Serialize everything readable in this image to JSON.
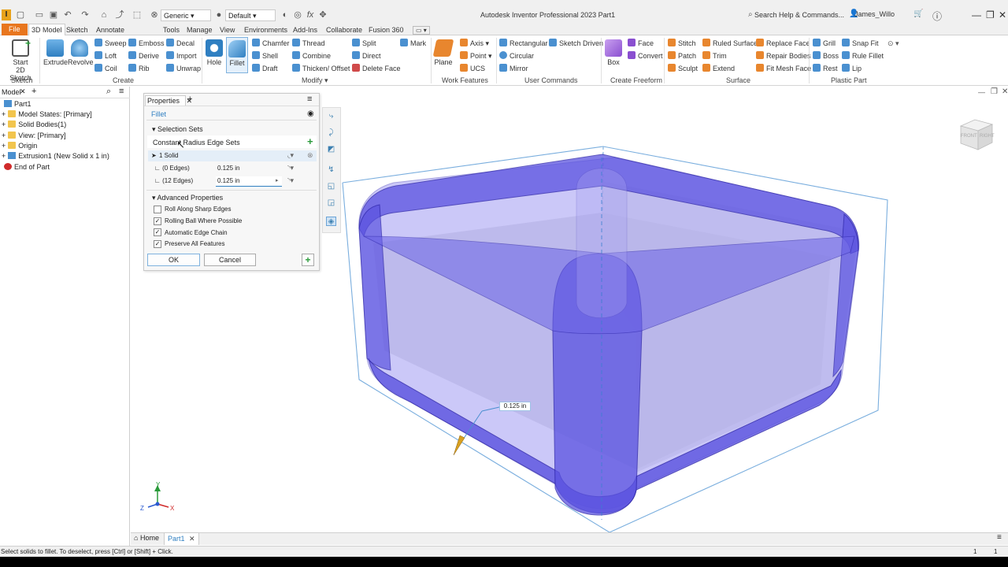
{
  "titlebar": {
    "logo": "I",
    "material_dropdown": "Generic",
    "appearance_dropdown": "Default",
    "window_title": "Autodesk Inventor Professional 2023    Part1",
    "search_placeholder": "Search Help & Commands...",
    "user": "James_Willo"
  },
  "tabs": [
    "File",
    "3D Model",
    "Sketch",
    "Annotate",
    "Tools",
    "Manage",
    "View",
    "Environments",
    "Add-Ins",
    "Collaborate",
    "Fusion 360"
  ],
  "ribbon": {
    "sketch": {
      "start_label": "Start\n2D Sketch",
      "panel": "Sketch"
    },
    "create": {
      "panel": "Create",
      "extrude": "Extrude",
      "revolve": "Revolve",
      "items": [
        "Sweep",
        "Loft",
        "Coil",
        "Emboss",
        "Derive",
        "Rib",
        "Decal",
        "Import",
        "Unwrap"
      ]
    },
    "modify": {
      "panel": "Modify",
      "hole": "Hole",
      "fillet": "Fillet",
      "items": [
        "Chamfer",
        "Shell",
        "Draft",
        "Thread",
        "Combine",
        "Thicken/ Offset",
        "Split",
        "Direct",
        "Delete Face",
        "Mark"
      ]
    },
    "work_features": {
      "panel": "Work Features",
      "plane": "Plane",
      "items": [
        "Axis",
        "Point",
        "UCS"
      ]
    },
    "user_commands": {
      "panel": "User Commands",
      "items": [
        "Rectangular",
        "Circular",
        "Mirror",
        "Sketch Driven"
      ]
    },
    "freeform": {
      "panel": "Create Freeform",
      "box": "Box",
      "items": [
        "Face",
        "Convert"
      ]
    },
    "surface": {
      "panel": "Surface",
      "items": [
        "Stitch",
        "Patch",
        "Sculpt",
        "Ruled Surface",
        "Trim",
        "Extend",
        "Replace Face",
        "Repair Bodies",
        "Fit Mesh Face"
      ]
    },
    "plastic": {
      "panel": "Plastic Part",
      "items": [
        "Grill",
        "Boss",
        "Rest",
        "Snap Fit",
        "Rule Fillet",
        "Lip"
      ]
    }
  },
  "browser": {
    "title": "Model",
    "tree": [
      "Part1",
      "Model States: [Primary]",
      "Solid Bodies(1)",
      "View: [Primary]",
      "Origin",
      "Extrusion1 (New Solid x 1 in)",
      "End of Part"
    ]
  },
  "properties": {
    "tab": "Properties",
    "feature": "Fillet",
    "selection_sets_header": "Selection Sets",
    "edge_sets_label": "Constant Radius Edge Sets",
    "solid_label": "1 Solid",
    "rows": [
      {
        "label": "(0 Edges)",
        "value": "0.125 in"
      },
      {
        "label": "(12 Edges)",
        "value": "0.125 in"
      }
    ],
    "advanced_header": "Advanced Properties",
    "options": [
      {
        "label": "Roll Along Sharp Edges",
        "checked": false
      },
      {
        "label": "Rolling Ball Where Possible",
        "checked": true
      },
      {
        "label": "Automatic Edge Chain",
        "checked": true
      },
      {
        "label": "Preserve All Features",
        "checked": true
      }
    ],
    "ok": "OK",
    "cancel": "Cancel"
  },
  "viewport": {
    "dimension_label": "0.125 in",
    "viewcube_front": "FRONT",
    "viewcube_right": "RIGHT",
    "axes": {
      "x": "X",
      "y": "Y",
      "z": "Z"
    }
  },
  "doc_tabs": {
    "home": "Home",
    "part": "Part1"
  },
  "status": {
    "message": "Select solids to fillet. To deselect, press [Ctrl] or [Shift] + Click.",
    "count_a": "1",
    "count_b": "1"
  },
  "colors": {
    "file_tab": "#e8761e",
    "fillet_blue": "#5a52e0",
    "accent": "#2f7fc1"
  }
}
